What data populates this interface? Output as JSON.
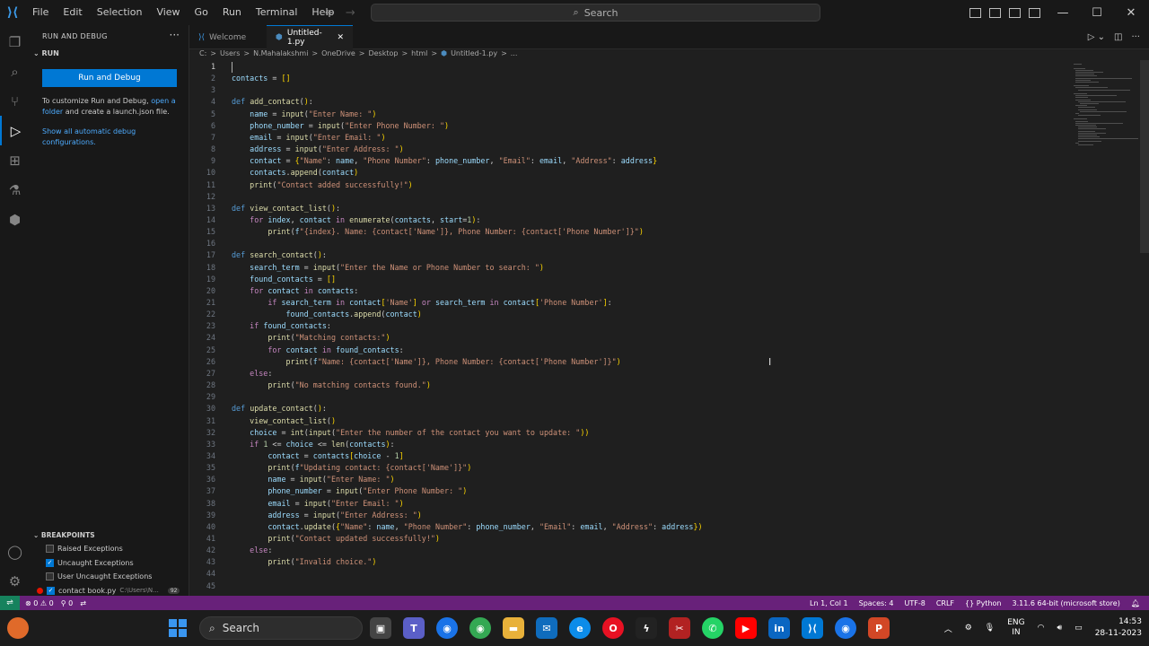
{
  "menu": [
    "File",
    "Edit",
    "Selection",
    "View",
    "Go",
    "Run",
    "Terminal",
    "Help"
  ],
  "search": {
    "label": "Search"
  },
  "sidebar": {
    "header": "RUN AND DEBUG",
    "section": "RUN",
    "run_button": "Run and Debug",
    "customize_text_1": "To customize Run and Debug,",
    "customize_link_1": "open a",
    "customize_link_2": "folder",
    "customize_text_2": "and create a launch.json file.",
    "show_all_link": "Show all automatic debug configurations.",
    "breakpoints": {
      "header": "BREAKPOINTS",
      "items": [
        {
          "label": "Raised Exceptions",
          "checked": false
        },
        {
          "label": "Uncaught Exceptions",
          "checked": true
        },
        {
          "label": "User Uncaught Exceptions",
          "checked": false
        }
      ],
      "file": {
        "label": "contact book.py",
        "path": "C:\\Users\\N...",
        "count": "92"
      }
    }
  },
  "tabs": [
    {
      "label": "Welcome",
      "active": false
    },
    {
      "label": "Untitled-1.py",
      "active": true
    }
  ],
  "breadcrumb": [
    "C:",
    ">",
    "Users",
    ">",
    "N.Mahalakshmi",
    ">",
    "OneDrive",
    ">",
    "Desktop",
    ">",
    "html",
    ">",
    "Untitled-1.py",
    ">",
    "..."
  ],
  "editor": {
    "lines": [
      "",
      "contacts = []",
      "",
      "def add_contact():",
      "    name = input(\"Enter Name: \")",
      "    phone_number = input(\"Enter Phone Number: \")",
      "    email = input(\"Enter Email: \")",
      "    address = input(\"Enter Address: \")",
      "    contact = {\"Name\": name, \"Phone Number\": phone_number, \"Email\": email, \"Address\": address}",
      "    contacts.append(contact)",
      "    print(\"Contact added successfully!\")",
      "",
      "def view_contact_list():",
      "    for index, contact in enumerate(contacts, start=1):",
      "        print(f\"{index}. Name: {contact['Name']}, Phone Number: {contact['Phone Number']}\")",
      "",
      "def search_contact():",
      "    search_term = input(\"Enter the Name or Phone Number to search: \")",
      "    found_contacts = []",
      "    for contact in contacts:",
      "        if search_term in contact['Name'] or search_term in contact['Phone Number']:",
      "            found_contacts.append(contact)",
      "    if found_contacts:",
      "        print(\"Matching contacts:\")",
      "        for contact in found_contacts:",
      "            print(f\"Name: {contact['Name']}, Phone Number: {contact['Phone Number']}\")",
      "    else:",
      "        print(\"No matching contacts found.\")",
      "",
      "def update_contact():",
      "    view_contact_list()",
      "    choice = int(input(\"Enter the number of the contact you want to update: \"))",
      "    if 1 <= choice <= len(contacts):",
      "        contact = contacts[choice - 1]",
      "        print(f\"Updating contact: {contact['Name']}\")",
      "        name = input(\"Enter Name: \")",
      "        phone_number = input(\"Enter Phone Number: \")",
      "        email = input(\"Enter Email: \")",
      "        address = input(\"Enter Address: \")",
      "        contact.update({\"Name\": name, \"Phone Number\": phone_number, \"Email\": email, \"Address\": address})",
      "        print(\"Contact updated successfully!\")",
      "    else:",
      "        print(\"Invalid choice.\")",
      "",
      ""
    ]
  },
  "status": {
    "errors": "0",
    "warnings": "0",
    "ports": "0",
    "position": "Ln 1, Col 1",
    "spaces": "Spaces: 4",
    "encoding": "UTF-8",
    "eol": "CRLF",
    "language": "Python",
    "interpreter": "3.11.6 64-bit (microsoft store)"
  },
  "taskbar": {
    "search": "Search",
    "lang_1": "ENG",
    "lang_2": "IN",
    "time": "14:53",
    "date": "28-11-2023"
  },
  "colors": {
    "accent": "#0078d4",
    "statusbar": "#68217a",
    "remote": "#16825d"
  }
}
